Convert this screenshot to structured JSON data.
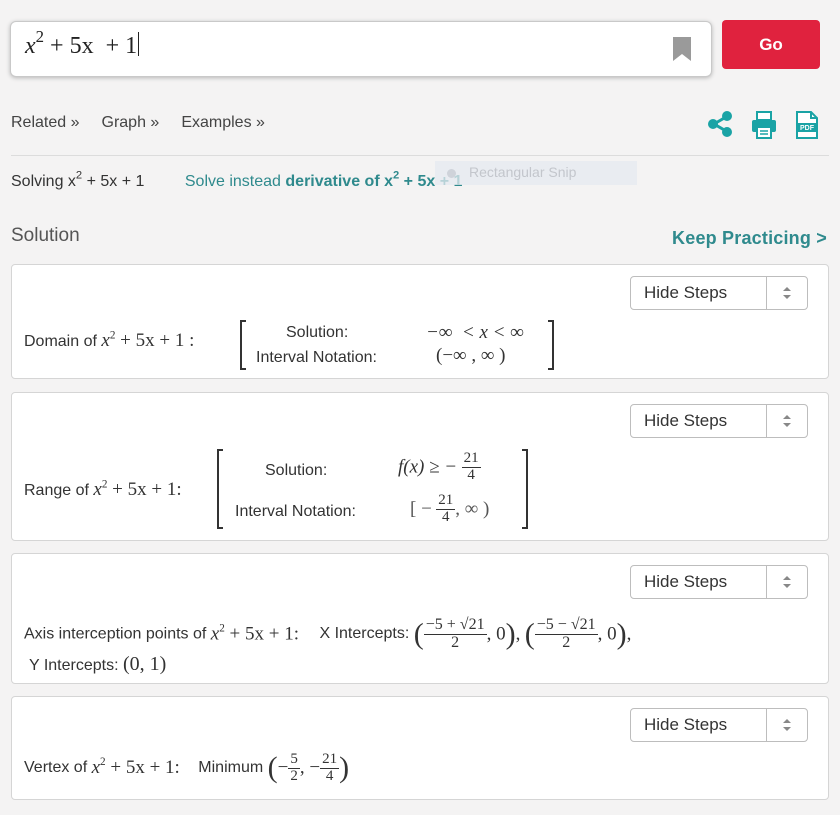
{
  "search": {
    "expression_base": "x",
    "expression_exp": "2",
    "expression_rest": " + 5x  + 1",
    "bookmark_icon": "bookmark-icon"
  },
  "go_label": "Go",
  "nav": {
    "related": "Related »",
    "graph": "Graph »",
    "examples": "Examples »",
    "icons": [
      "share-icon",
      "print-icon",
      "pdf-icon"
    ]
  },
  "solving": {
    "prefix": "Solving x",
    "exp": "2",
    "rest": " + 5x + 1",
    "instead_prefix": "Solve instead ",
    "instead_bold": "derivative of x",
    "instead_exp": "2",
    "instead_rest": " + 5x + 1"
  },
  "snip_overlay": "Rectangular Snip",
  "solution_label": "Solution",
  "keep_practicing": "Keep Practicing >",
  "hide_steps": "Hide Steps",
  "domain": {
    "label": "Domain of ",
    "expr_base": "x",
    "expr_exp": "2",
    "expr_rest": " + 5x + 1 :",
    "solution_label": "Solution:",
    "interval_label": "Interval Notation:",
    "solution_value": "−∞  < x < ∞",
    "interval_value": "(−∞ , ∞ )"
  },
  "range": {
    "label": "Range of ",
    "expr_base": "x",
    "expr_exp": "2",
    "expr_rest": " + 5x + 1:",
    "solution_label": "Solution:",
    "interval_label": "Interval Notation:",
    "solution_lhs": "f(x) ≥ −",
    "frac_num": "21",
    "frac_den": "4",
    "interval_open": "[ −",
    "interval_close": ", ∞ )"
  },
  "axis": {
    "label": "Axis interception points of ",
    "expr_base": "x",
    "expr_exp": "2",
    "expr_rest": " + 5x + 1:",
    "x_label": "X Intercepts:",
    "x1_num": "−5 + √21",
    "x2_num": "−5 − √21",
    "den": "2",
    "zero_tail": ", 0",
    "y_label": "Y Intercepts:",
    "y_value": "(0, 1)"
  },
  "vertex": {
    "label": "Vertex of ",
    "expr_base": "x",
    "expr_exp": "2",
    "expr_rest": " + 5x + 1:",
    "minimum_label": "Minimum",
    "x_num": "5",
    "x_den": "2",
    "y_num": "21",
    "y_den": "4"
  },
  "colors": {
    "accent_red": "#e0223e",
    "teal": "#2f8a8d",
    "background": "#f4f3f3"
  }
}
